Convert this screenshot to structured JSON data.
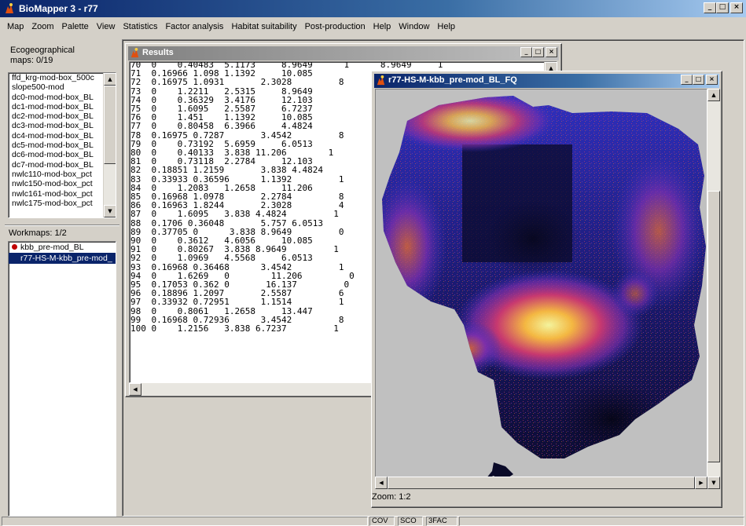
{
  "app": {
    "title": "BioMapper 3 - r77",
    "window_buttons": [
      "_",
      "□",
      "×"
    ]
  },
  "menubar": {
    "items": [
      "Map",
      "Zoom",
      "Palette",
      "View",
      "Statistics",
      "Factor analysis",
      "Habitat suitability",
      "Post-production",
      "Help",
      "Window",
      "Help"
    ]
  },
  "left_panel": {
    "ecogeo_label_1": "Ecogeographical",
    "ecogeo_label_2": "maps: 0/19",
    "ecogeo_maps": [
      "ffd_krg-mod-box_500c",
      "slope500-mod",
      "dc0-mod-mod-box_BL",
      "dc1-mod-mod-box_BL",
      "dc2-mod-mod-box_BL",
      "dc3-mod-mod-box_BL",
      "dc4-mod-mod-box_BL",
      "dc5-mod-mod-box_BL",
      "dc6-mod-mod-box_BL",
      "dc7-mod-mod-box_BL",
      "nwlc110-mod-box_pct",
      "nwlc150-mod-box_pct",
      "nwlc161-mod-box_pct",
      "nwlc175-mod-box_pct"
    ],
    "workmaps_label": "Workmaps: 1/2",
    "workmaps": [
      {
        "name": "kbb_pre-mod_BL",
        "selected": false,
        "dot_color": "#c00000"
      },
      {
        "name": "r77-HS-M-kbb_pre-mod_",
        "selected": true
      }
    ]
  },
  "results_window": {
    "title": "Results",
    "lines": [
      "70  0    0.40483  5.1173     8.9649      1      8.9649     1",
      "71  0.16966 1.098 1.1392     10.085",
      "72  0.16975 1.0931       2.3028         8",
      "73  0    1.2211   2.5315     8.9649",
      "74  0    0.36329  3.4176     12.103",
      "75  0    1.6095   2.5587     6.7237",
      "76  0    1.451    1.1392     10.085",
      "77  0    0.80458  6.3966     4.4824",
      "78  0.16975 0.7287       3.4542         8",
      "79  0    0.73192  5.6959     6.0513",
      "80  0    0.40133  3.838 11.206        1",
      "81  0    0.73118  2.2784     12.103",
      "82  0.18851 1.2159       3.838 4.4824",
      "83  0.33933 0.36596      1.1392         1",
      "84  0    1.2083   1.2658     11.206",
      "85  0.16968 1.0978       2.2784         8",
      "86  0.16963 1.8244       2.3028         4",
      "87  0    1.6095   3.838 4.4824         1",
      "88  0.1706 0.36048       5.757 6.0513",
      "89  0.37705 0      3.838 8.9649         0",
      "90  0    0.3612   4.6056     10.085",
      "91  0    0.80267  3.838 8.9649         1",
      "92  0    1.0969   4.5568     6.0513",
      "93  0.16968 0.36468      3.4542         1",
      "94  0    1.6269   0        11.206         0",
      "95  0.17053 0.362 0       16.137         0",
      "96  0.18896 1.2097       2.5587         6",
      "97  0.33932 0.72951      1.1514         1",
      "98  0    0.8061   1.2658     13.447",
      "99  0.16968 0.72936      3.4542         8",
      "100 0    1.2156   3.838 6.7237         1"
    ]
  },
  "map_window": {
    "title": "r77-HS-M-kbb_pre-mod_BL_FQ",
    "zoom_label": "Zoom: 1:2",
    "palette": [
      "#0a0a28",
      "#1a1a70",
      "#3030c0",
      "#8030b0",
      "#d03a70",
      "#f07030",
      "#ffc040",
      "#ffffa0"
    ],
    "background_color": "#c0c0c0"
  },
  "statusbar": {
    "segments": [
      "COV",
      "SCO",
      "3FAC"
    ]
  }
}
